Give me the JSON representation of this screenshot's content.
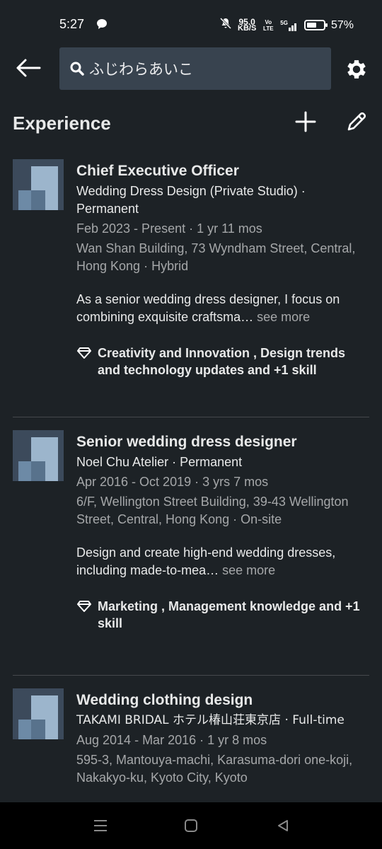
{
  "status_bar": {
    "time": "5:27",
    "speed_value": "95.0",
    "speed_unit": "KB/S",
    "volte": "Vo LTE",
    "network": "5G",
    "battery_percent": "57%",
    "battery_level": 0.57
  },
  "search": {
    "value": "ふじわらあいこ"
  },
  "section": {
    "title": "Experience"
  },
  "experience": [
    {
      "title": "Chief Executive Officer",
      "company": "Wedding Dress Design (Private Studio) · Permanent",
      "dates": "Feb 2023 - Present · 1 yr 11 mos",
      "location": "Wan Shan Building, 73 Wyndham Street, Central, Hong Kong · Hybrid",
      "description": "As a senior wedding dress designer, I focus on combining exquisite craftsma…",
      "see_more": "see more",
      "skills": "Creativity and Innovation , Design trends and technology updates and +1 skill"
    },
    {
      "title": "Senior wedding dress designer",
      "company": "Noel Chu Atelier · Permanent",
      "dates": "Apr 2016 - Oct 2019 · 3 yrs 7 mos",
      "location": "6/F, Wellington Street Building, 39-43 Wellington Street, Central, Hong Kong · On-site",
      "description": "Design and create high-end wedding dresses, including made-to-mea…",
      "see_more": "see more",
      "skills": "Marketing , Management knowledge and +1 skill"
    },
    {
      "title": "Wedding clothing design",
      "company": "TAKAMI BRIDAL ホテル椿山荘東京店 · Full-time",
      "dates": "Aug 2014 - Mar 2016 · 1 yr 8 mos",
      "location": "595-3, Mantouya-machi, Karasuma-dori one-koji, Nakakyo-ku, Kyoto City, Kyoto"
    }
  ],
  "colors": {
    "background": "#1d2226",
    "search_background": "#38434f",
    "text_primary": "#ffffffe6",
    "text_secondary": "#ffffff99"
  },
  "icons": {
    "back": "arrow-left-icon",
    "search": "search-icon",
    "settings": "gear-icon",
    "add": "plus-icon",
    "edit": "pencil-icon",
    "skill": "diamond-icon",
    "nav_menu": "menu-icon",
    "nav_home": "home-square-icon",
    "nav_back": "triangle-back-icon"
  }
}
